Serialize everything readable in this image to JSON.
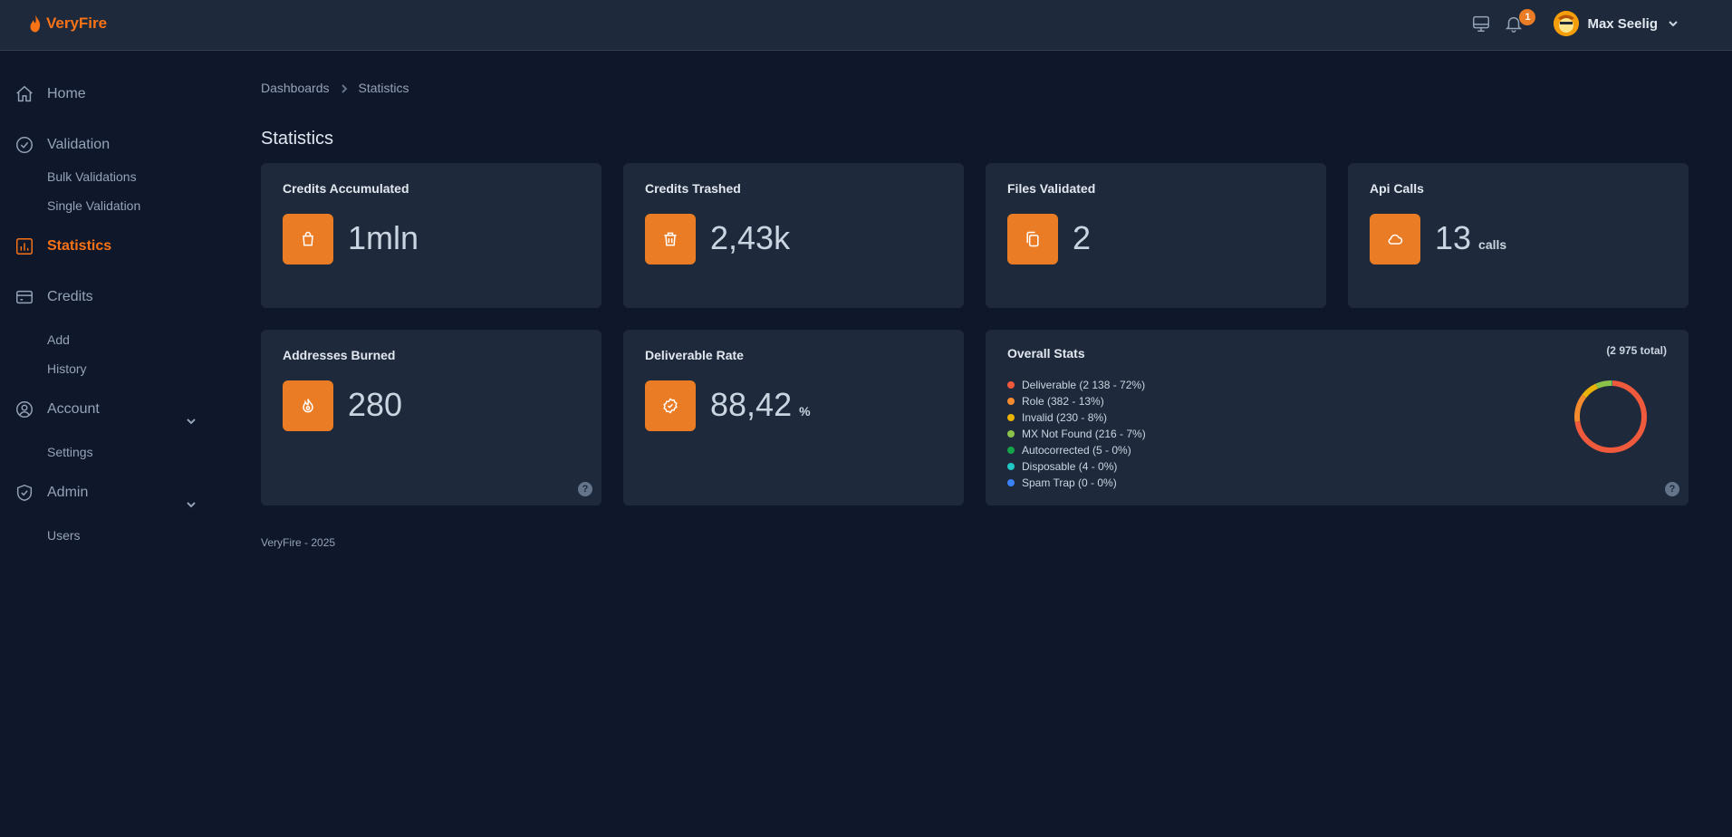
{
  "app": {
    "name": "VeryFire"
  },
  "header": {
    "notifications_count": "1",
    "user_name": "Max Seelig"
  },
  "sidebar": {
    "home": "Home",
    "validation": "Validation",
    "bulk_validations": "Bulk Validations",
    "single_validation": "Single Validation",
    "statistics": "Statistics",
    "credits": "Credits",
    "add": "Add",
    "history": "History",
    "account": "Account",
    "settings": "Settings",
    "admin": "Admin",
    "users": "Users"
  },
  "breadcrumb": {
    "root": "Dashboards",
    "current": "Statistics"
  },
  "page_title": "Statistics",
  "cards": {
    "credits_accumulated": {
      "title": "Credits Accumulated",
      "value": "1mln",
      "icon": "shopping-bag-icon"
    },
    "credits_trashed": {
      "title": "Credits Trashed",
      "value": "2,43k",
      "icon": "trash-icon"
    },
    "files_validated": {
      "title": "Files Validated",
      "value": "2",
      "icon": "files-icon"
    },
    "api_calls": {
      "title": "Api Calls",
      "value": "13",
      "unit": "calls",
      "icon": "cloud-icon"
    },
    "addresses_burned": {
      "title": "Addresses Burned",
      "value": "280",
      "icon": "fire-icon"
    },
    "deliverable_rate": {
      "title": "Deliverable Rate",
      "value": "88,42",
      "unit": "%",
      "icon": "badge-check-icon"
    }
  },
  "overall_stats": {
    "title": "Overall Stats",
    "total": "(2 975 total)",
    "legend": [
      {
        "label": "Deliverable (2 138 - 72%)",
        "color": "#ef5a3c"
      },
      {
        "label": "Role (382 - 13%)",
        "color": "#f58a2e"
      },
      {
        "label": "Invalid (230 - 8%)",
        "color": "#eab308"
      },
      {
        "label": "MX Not Found (216 - 7%)",
        "color": "#8bc34a"
      },
      {
        "label": "Autocorrected (5 - 0%)",
        "color": "#16a34a"
      },
      {
        "label": "Disposable (4 - 0%)",
        "color": "#22c7c7"
      },
      {
        "label": "Spam Trap (0 - 0%)",
        "color": "#3b82f6"
      }
    ]
  },
  "chart_data": {
    "type": "pie",
    "categories": [
      "Deliverable",
      "Role",
      "Invalid",
      "MX Not Found",
      "Autocorrected",
      "Disposable",
      "Spam Trap"
    ],
    "values": [
      2138,
      382,
      230,
      216,
      5,
      4,
      0
    ],
    "colors": [
      "#ef5a3c",
      "#f58a2e",
      "#eab308",
      "#8bc34a",
      "#16a34a",
      "#22c7c7",
      "#3b82f6"
    ],
    "donut": true
  },
  "footer": "VeryFire - 2025",
  "help_glyph": "?"
}
